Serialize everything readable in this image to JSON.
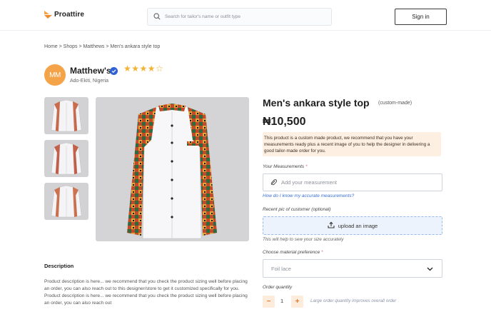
{
  "header": {
    "brand": "Proattire",
    "search_placeholder": "Search for tailor's name or outfit type",
    "signin_label": "Sign in"
  },
  "breadcrumb": "Home > Shops > Matthews > Men's ankara style top",
  "store": {
    "initials": "MM",
    "name": "Matthew's",
    "location": "Ado-Ekiti, Nigeria",
    "rating": 4,
    "rating_max": 5
  },
  "product": {
    "title": "Men's ankara style top",
    "tag": "(custom-made)",
    "price": "₦10,500",
    "notice": "This product is a custom made product, we recommend that you have your measurements ready plus a recent image of you to help the designer in delivering a good tailor-made order for you.",
    "description_title": "Description",
    "description": "Product description is here... we recommend that you check the product sizing well before placing an order, you can also reach out to this designer/store to get it customized specifically for you. Product description is here... we recommend that you check the product sizing well before placing an order, you can also reach out"
  },
  "form": {
    "measurements_label": "Your Measurements",
    "measurements_required": "*",
    "measurements_placeholder": "Add your measurement",
    "measurements_link": "How do I know my accurate measurements?",
    "pic_label": "Recent pic of customer (optional)",
    "upload_label": "upload an image",
    "upload_hint": "This will help to sew your size accurately",
    "material_label": "Choose material preference",
    "material_required": "*",
    "material_value": "Foil lace",
    "quantity_label": "Order quantity",
    "quantity_minus": "−",
    "quantity_value": "1",
    "quantity_plus": "+",
    "quantity_note": "Large order quantity improves overall order"
  },
  "colors": {
    "brand_orange": "#f5a349",
    "link_blue": "#3a6fd8",
    "verified_blue": "#2f62d6",
    "star": "#f2b233"
  }
}
